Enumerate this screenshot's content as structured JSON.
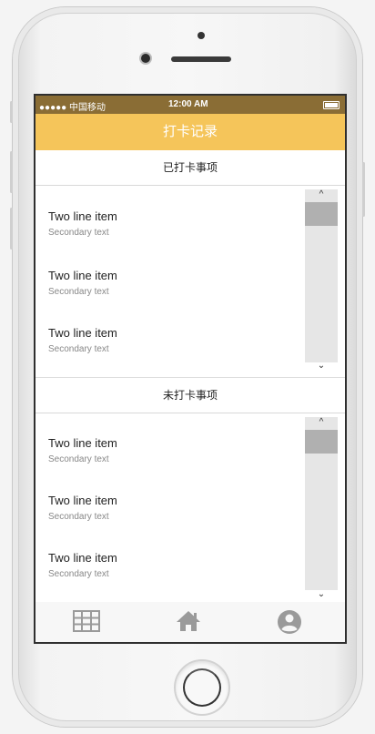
{
  "status": {
    "carrier": "●●●●● 中国移动",
    "time": "12:00 AM"
  },
  "header": {
    "title": "打卡记录"
  },
  "sections": [
    {
      "title": "已打卡事项",
      "items": [
        {
          "primary": "Two line item",
          "secondary": "Secondary text"
        },
        {
          "primary": "Two line item",
          "secondary": "Secondary text"
        },
        {
          "primary": "Two line item",
          "secondary": "Secondary text"
        }
      ]
    },
    {
      "title": "未打卡事项",
      "items": [
        {
          "primary": "Two line item",
          "secondary": "Secondary text"
        },
        {
          "primary": "Two line item",
          "secondary": "Secondary text"
        },
        {
          "primary": "Two line item",
          "secondary": "Secondary text"
        }
      ]
    }
  ],
  "scroll": {
    "up_glyph": "^",
    "down_glyph": "⌄"
  },
  "tabs": [
    {
      "icon": "grid-icon"
    },
    {
      "icon": "home-icon"
    },
    {
      "icon": "account-circle-icon"
    }
  ],
  "colors": {
    "header": "#f5c55a",
    "status_bar": "#8a6d35",
    "tab_icon": "#9a9a9a"
  }
}
